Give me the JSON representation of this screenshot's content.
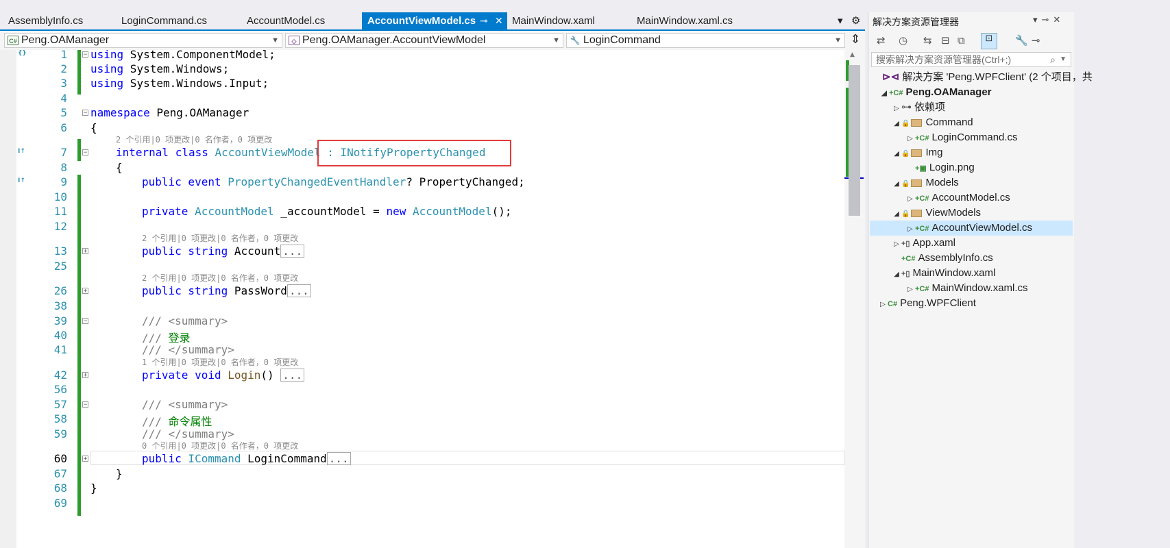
{
  "tabs": [
    {
      "label": "AssemblyInfo.cs",
      "active": false
    },
    {
      "label": "LoginCommand.cs",
      "active": false
    },
    {
      "label": "AccountModel.cs",
      "active": false
    },
    {
      "label": "AccountViewModel.cs",
      "active": true
    },
    {
      "label": "MainWindow.xaml",
      "active": false
    },
    {
      "label": "MainWindow.xaml.cs",
      "active": false
    }
  ],
  "tab_pin": "⊸",
  "tab_close": "✕",
  "nav": {
    "project": "Peng.OAManager",
    "type": "Peng.OAManager.AccountViewModel",
    "member": "LoginCommand"
  },
  "code": {
    "line_numbers": [
      "1",
      "2",
      "3",
      "4",
      "5",
      "6",
      "7",
      "8",
      "9",
      "10",
      "11",
      "12",
      "13",
      "25",
      "26",
      "38",
      "39",
      "40",
      "41",
      "42",
      "56",
      "57",
      "58",
      "59",
      "60",
      "67",
      "68",
      "69"
    ],
    "using1": "using",
    "using1_ns": " System.ComponentModel;",
    "using2": "using",
    "using2_ns": " System.Windows;",
    "using3": "using",
    "using3_ns": " System.Windows.Input;",
    "namespace_kw": "namespace",
    "namespace_name": " Peng.OAManager",
    "open_brace": "{",
    "lens_class": "2 个引用|0 项更改|0 名作者，0 项更改",
    "class_kw": "internal class",
    "class_name": " AccountViewModel",
    "class_base": " : INotifyPropertyChanged",
    "class_open": "{",
    "event_kw": "public event",
    "event_type": " PropertyChangedEventHandler",
    "event_rest": "? PropertyChanged;",
    "field_kw": "private",
    "field_type": " AccountModel",
    "field_name": " _accountModel = ",
    "field_new": "new",
    "field_ctor": " AccountModel",
    "field_end": "();",
    "lens_account": "2 个引用|0 项更改|0 名作者，0 项更改",
    "account_kw": "public string",
    "account_name": " Account",
    "collapsed": "...",
    "lens_password": "2 个引用|0 项更改|0 名作者，0 项更改",
    "password_kw": "public string",
    "password_name": " PassWord",
    "summary1_open": "/// <summary>",
    "summary1_text_prefix": "/// ",
    "summary1_text": "登录",
    "summary1_close": "/// </summary>",
    "lens_login": "1 个引用|0 项更改|0 名作者，0 项更改",
    "login_kw": "private void",
    "login_name": " Login",
    "login_parens": "() ",
    "summary2_open": "/// <summary>",
    "summary2_text_prefix": "/// ",
    "summary2_text": "命令属性",
    "summary2_close": "/// </summary>",
    "lens_cmd": "0 个引用|0 项更改|0 名作者，0 项更改",
    "cmd_kw": "public",
    "cmd_type": " ICommand",
    "cmd_name": " LoginCommand",
    "class_close": "}",
    "ns_close": "}"
  },
  "solution_explorer": {
    "title": "解决方案资源管理器",
    "search_placeholder": "搜索解决方案资源管理器(Ctrl+;)",
    "items": [
      {
        "label": "解决方案 'Peng.WPFClient' (2 个项目，共",
        "kind": "solution"
      },
      {
        "label": "Peng.OAManager",
        "kind": "project"
      },
      {
        "label": "依赖项",
        "kind": "deps"
      },
      {
        "label": "Command",
        "kind": "folder"
      },
      {
        "label": "LoginCommand.cs",
        "kind": "cs"
      },
      {
        "label": "Img",
        "kind": "folder"
      },
      {
        "label": "Login.png",
        "kind": "png"
      },
      {
        "label": "Models",
        "kind": "folder"
      },
      {
        "label": "AccountModel.cs",
        "kind": "cs"
      },
      {
        "label": "ViewModels",
        "kind": "folder"
      },
      {
        "label": "AccountViewModel.cs",
        "kind": "cs"
      },
      {
        "label": "App.xaml",
        "kind": "xaml"
      },
      {
        "label": "AssemblyInfo.cs",
        "kind": "cs"
      },
      {
        "label": "MainWindow.xaml",
        "kind": "xaml"
      },
      {
        "label": "MainWindow.xaml.cs",
        "kind": "cs"
      },
      {
        "label": "Peng.WPFClient",
        "kind": "project"
      }
    ]
  },
  "colors": {
    "accent": "#007acc",
    "highlight_border": "#e23b3b",
    "change_bar": "#2e9b2e"
  }
}
